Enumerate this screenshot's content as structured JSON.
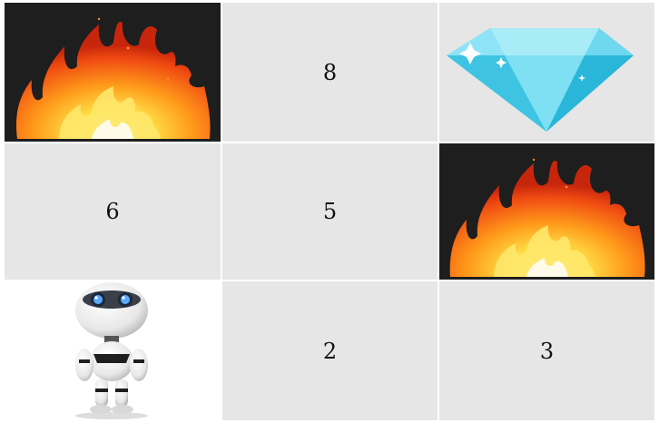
{
  "grid": {
    "rows": 3,
    "cols": 3,
    "cells": [
      {
        "type": "image",
        "icon": "fire-icon"
      },
      {
        "type": "number",
        "value": "8"
      },
      {
        "type": "image",
        "icon": "diamond-icon"
      },
      {
        "type": "number",
        "value": "6"
      },
      {
        "type": "number",
        "value": "5"
      },
      {
        "type": "image",
        "icon": "fire-icon"
      },
      {
        "type": "image",
        "icon": "robot-icon"
      },
      {
        "type": "number",
        "value": "2"
      },
      {
        "type": "number",
        "value": "3"
      }
    ]
  },
  "colors": {
    "cell_background": "#e6e6e6",
    "fire_background": "#1e1e1e",
    "diamond": "#3cc8e6",
    "grid_lines": "#ffffff"
  }
}
